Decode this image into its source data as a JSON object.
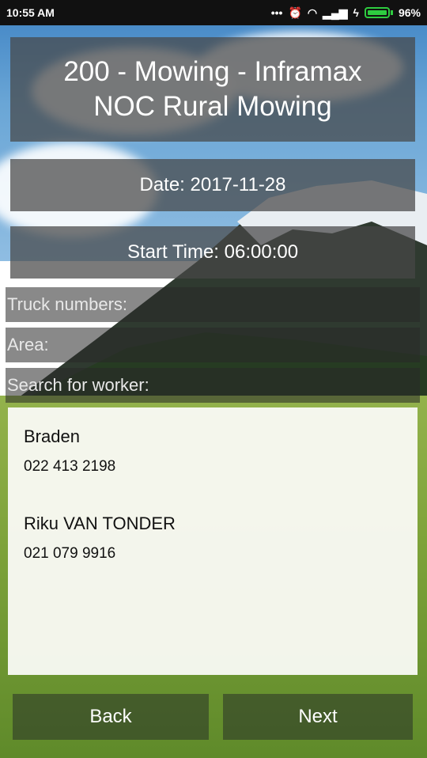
{
  "status_bar": {
    "time": "10:55 AM",
    "battery": "96%"
  },
  "title": {
    "line1": "200 - Mowing - Inframax",
    "line2": "NOC Rural Mowing"
  },
  "date_label": "Date: 2017-11-28",
  "start_time_label": "Start Time: 06:00:00",
  "fields": {
    "truck_numbers_placeholder": "Truck numbers:",
    "area_placeholder": "Area:",
    "search_placeholder": "Search for worker:"
  },
  "workers": [
    {
      "name": "Braden",
      "phone": "022 413 2198"
    },
    {
      "name": "Riku VAN TONDER",
      "phone": "021 079 9916"
    }
  ],
  "buttons": {
    "back": "Back",
    "next": "Next"
  },
  "colors": {
    "battery": "#2ecc40",
    "panel": "#464646"
  }
}
